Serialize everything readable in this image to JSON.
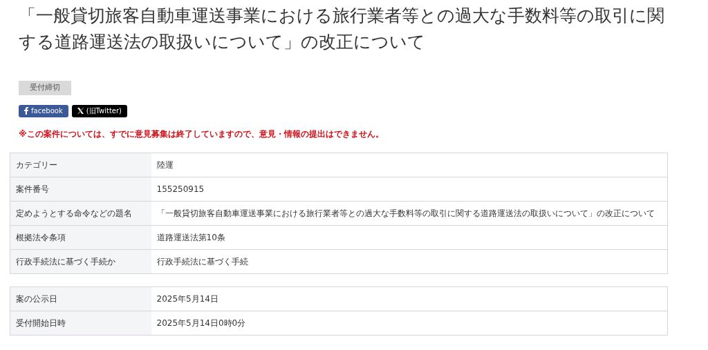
{
  "title": "「一般貸切旅客自動車運送事業における旅行業者等との過大な手数料等の取引に関する道路運送法の取扱いについて」の改正について",
  "status_badge": "受付締切",
  "share_buttons": [
    {
      "kind": "facebook",
      "label": "facebook"
    },
    {
      "kind": "x",
      "label": "(旧Twitter)"
    }
  ],
  "notice": "※この案件については、すでに意見募集は終了していますので、意見・情報の提出はできません。",
  "tables": [
    {
      "rows": [
        {
          "label": "カテゴリー",
          "value": "陸運"
        },
        {
          "label": "案件番号",
          "value": "155250915"
        },
        {
          "label": "定めようとする命令などの題名",
          "value": "「一般貸切旅客自動車運送事業における旅行業者等との過大な手数料等の取引に関する道路運送法の取扱いについて」の改正について"
        },
        {
          "label": "根拠法令条項",
          "value": "道路運送法第10条"
        },
        {
          "label": "行政手続法に基づく手続か",
          "value": "行政手続法に基づく手続"
        }
      ]
    },
    {
      "rows": [
        {
          "label": "案の公示日",
          "value": "2025年5月14日"
        },
        {
          "label": "受付開始日時",
          "value": "2025年5月14日0時0分"
        }
      ]
    }
  ]
}
